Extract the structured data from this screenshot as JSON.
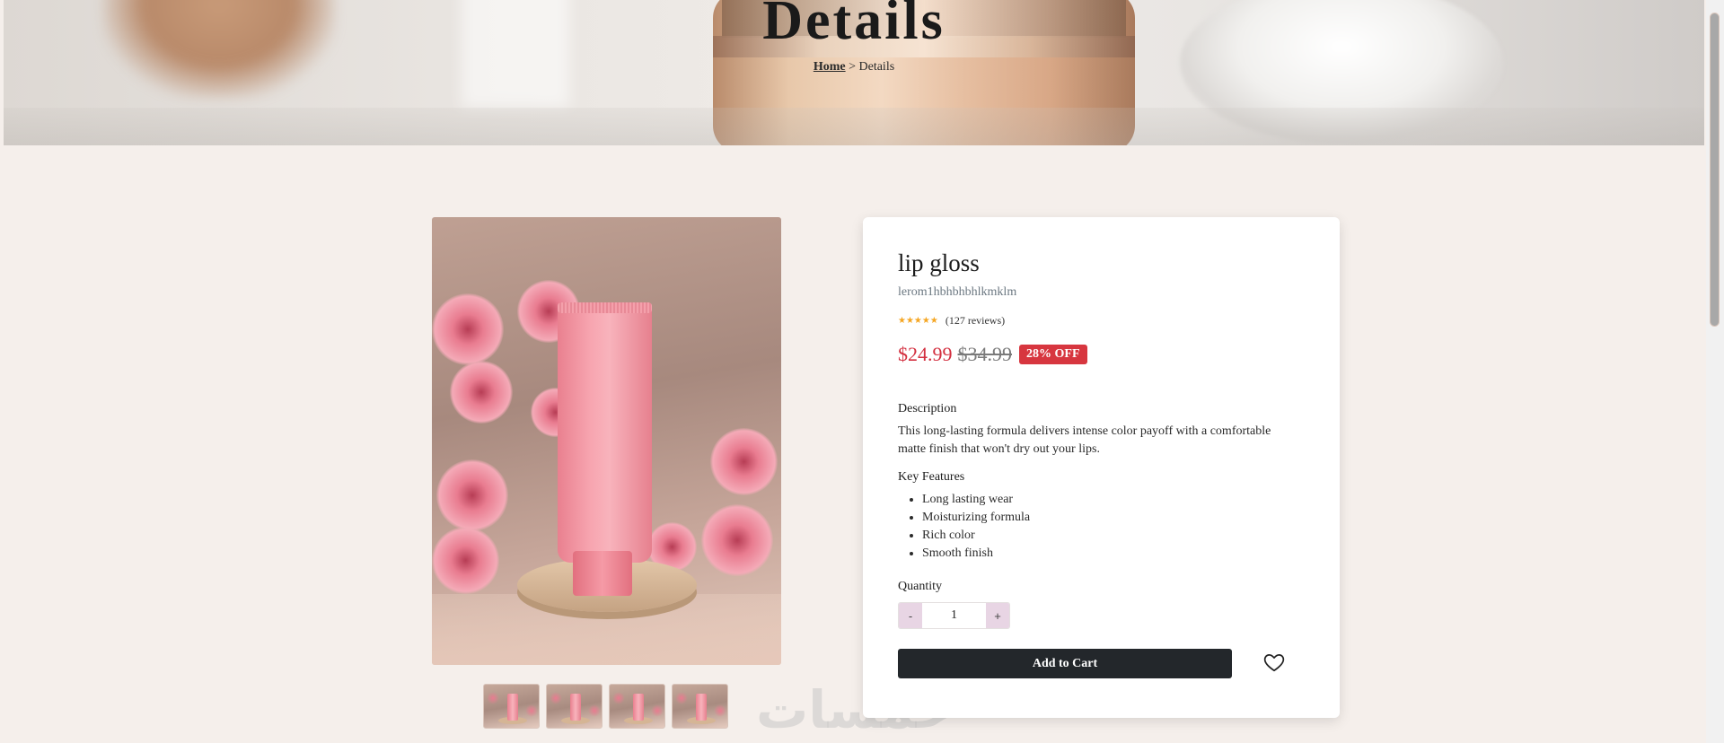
{
  "hero": {
    "title": "Details",
    "breadcrumb": {
      "home": "Home",
      "separator": ">",
      "current": "Details"
    }
  },
  "product": {
    "title": "lip gloss",
    "sku": "lerom1hbhbhbhlkmklm",
    "rating": {
      "stars": "★★★★★",
      "value": 5,
      "reviews_text": "(127 reviews)"
    },
    "price": "$24.99",
    "old_price": "$34.99",
    "discount_badge": "28% OFF",
    "description_label": "Description",
    "description": "This long-lasting formula delivers intense color payoff with a comfortable matte finish that won't dry out your lips.",
    "features_label": "Key Features",
    "features": [
      "Long lasting wear",
      "Moisturizing formula",
      "Rich color",
      "Smooth finish"
    ],
    "quantity_label": "Quantity",
    "quantity": {
      "minus": "-",
      "value": "1",
      "plus": "+"
    },
    "add_to_cart_label": "Add to Cart",
    "wishlist_icon": "heart-icon"
  },
  "gallery": {
    "thumbnail_count": 4
  },
  "watermark": "خمسات",
  "colors": {
    "price": "#d32f3f",
    "badge": "#d7363f",
    "button": "#23272b",
    "background": "#f5efeb",
    "stepper": "#e8d5e4"
  }
}
